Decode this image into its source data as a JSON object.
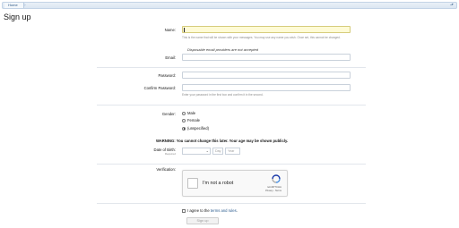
{
  "breadcrumb": {
    "home": "Home"
  },
  "page": {
    "title": "Sign up"
  },
  "form": {
    "name": {
      "label": "Name:",
      "value": "",
      "hint": "This is the name that will be shown with your messages. You may use any name you wish. Once set, this cannot be changed."
    },
    "email": {
      "note": "Disposable email providers are not accepted",
      "label": "Email:",
      "value": ""
    },
    "password": {
      "label": "Password:",
      "value": ""
    },
    "confirm_password": {
      "label": "Confirm Password:",
      "value": "",
      "hint": "Enter your password in the first box and confirm it in the second."
    },
    "gender": {
      "label": "Gender:",
      "options": [
        "Male",
        "Female",
        "(unspecified)"
      ],
      "selected": "(unspecified)"
    },
    "warning": "WARNING: You cannot change this later. Your age may be shown publicly.",
    "dob": {
      "label": "Date of Birth:",
      "required": "Required",
      "month_value": "",
      "day_placeholder": "Day",
      "year_placeholder": "Year"
    },
    "verification": {
      "label": "Verification:",
      "captcha_text": "I'm not a robot",
      "brand": "reCAPTCHA",
      "links": "Privacy - Terms"
    },
    "agree": {
      "prefix": "I agree to the",
      "link": "terms and rules",
      "suffix": "."
    },
    "submit_label": "Sign up"
  },
  "colors": {
    "focused_input_bg": "#fffbd6",
    "link": "#2a5b8e",
    "breadcrumb_bg": "#dbe6f2"
  }
}
